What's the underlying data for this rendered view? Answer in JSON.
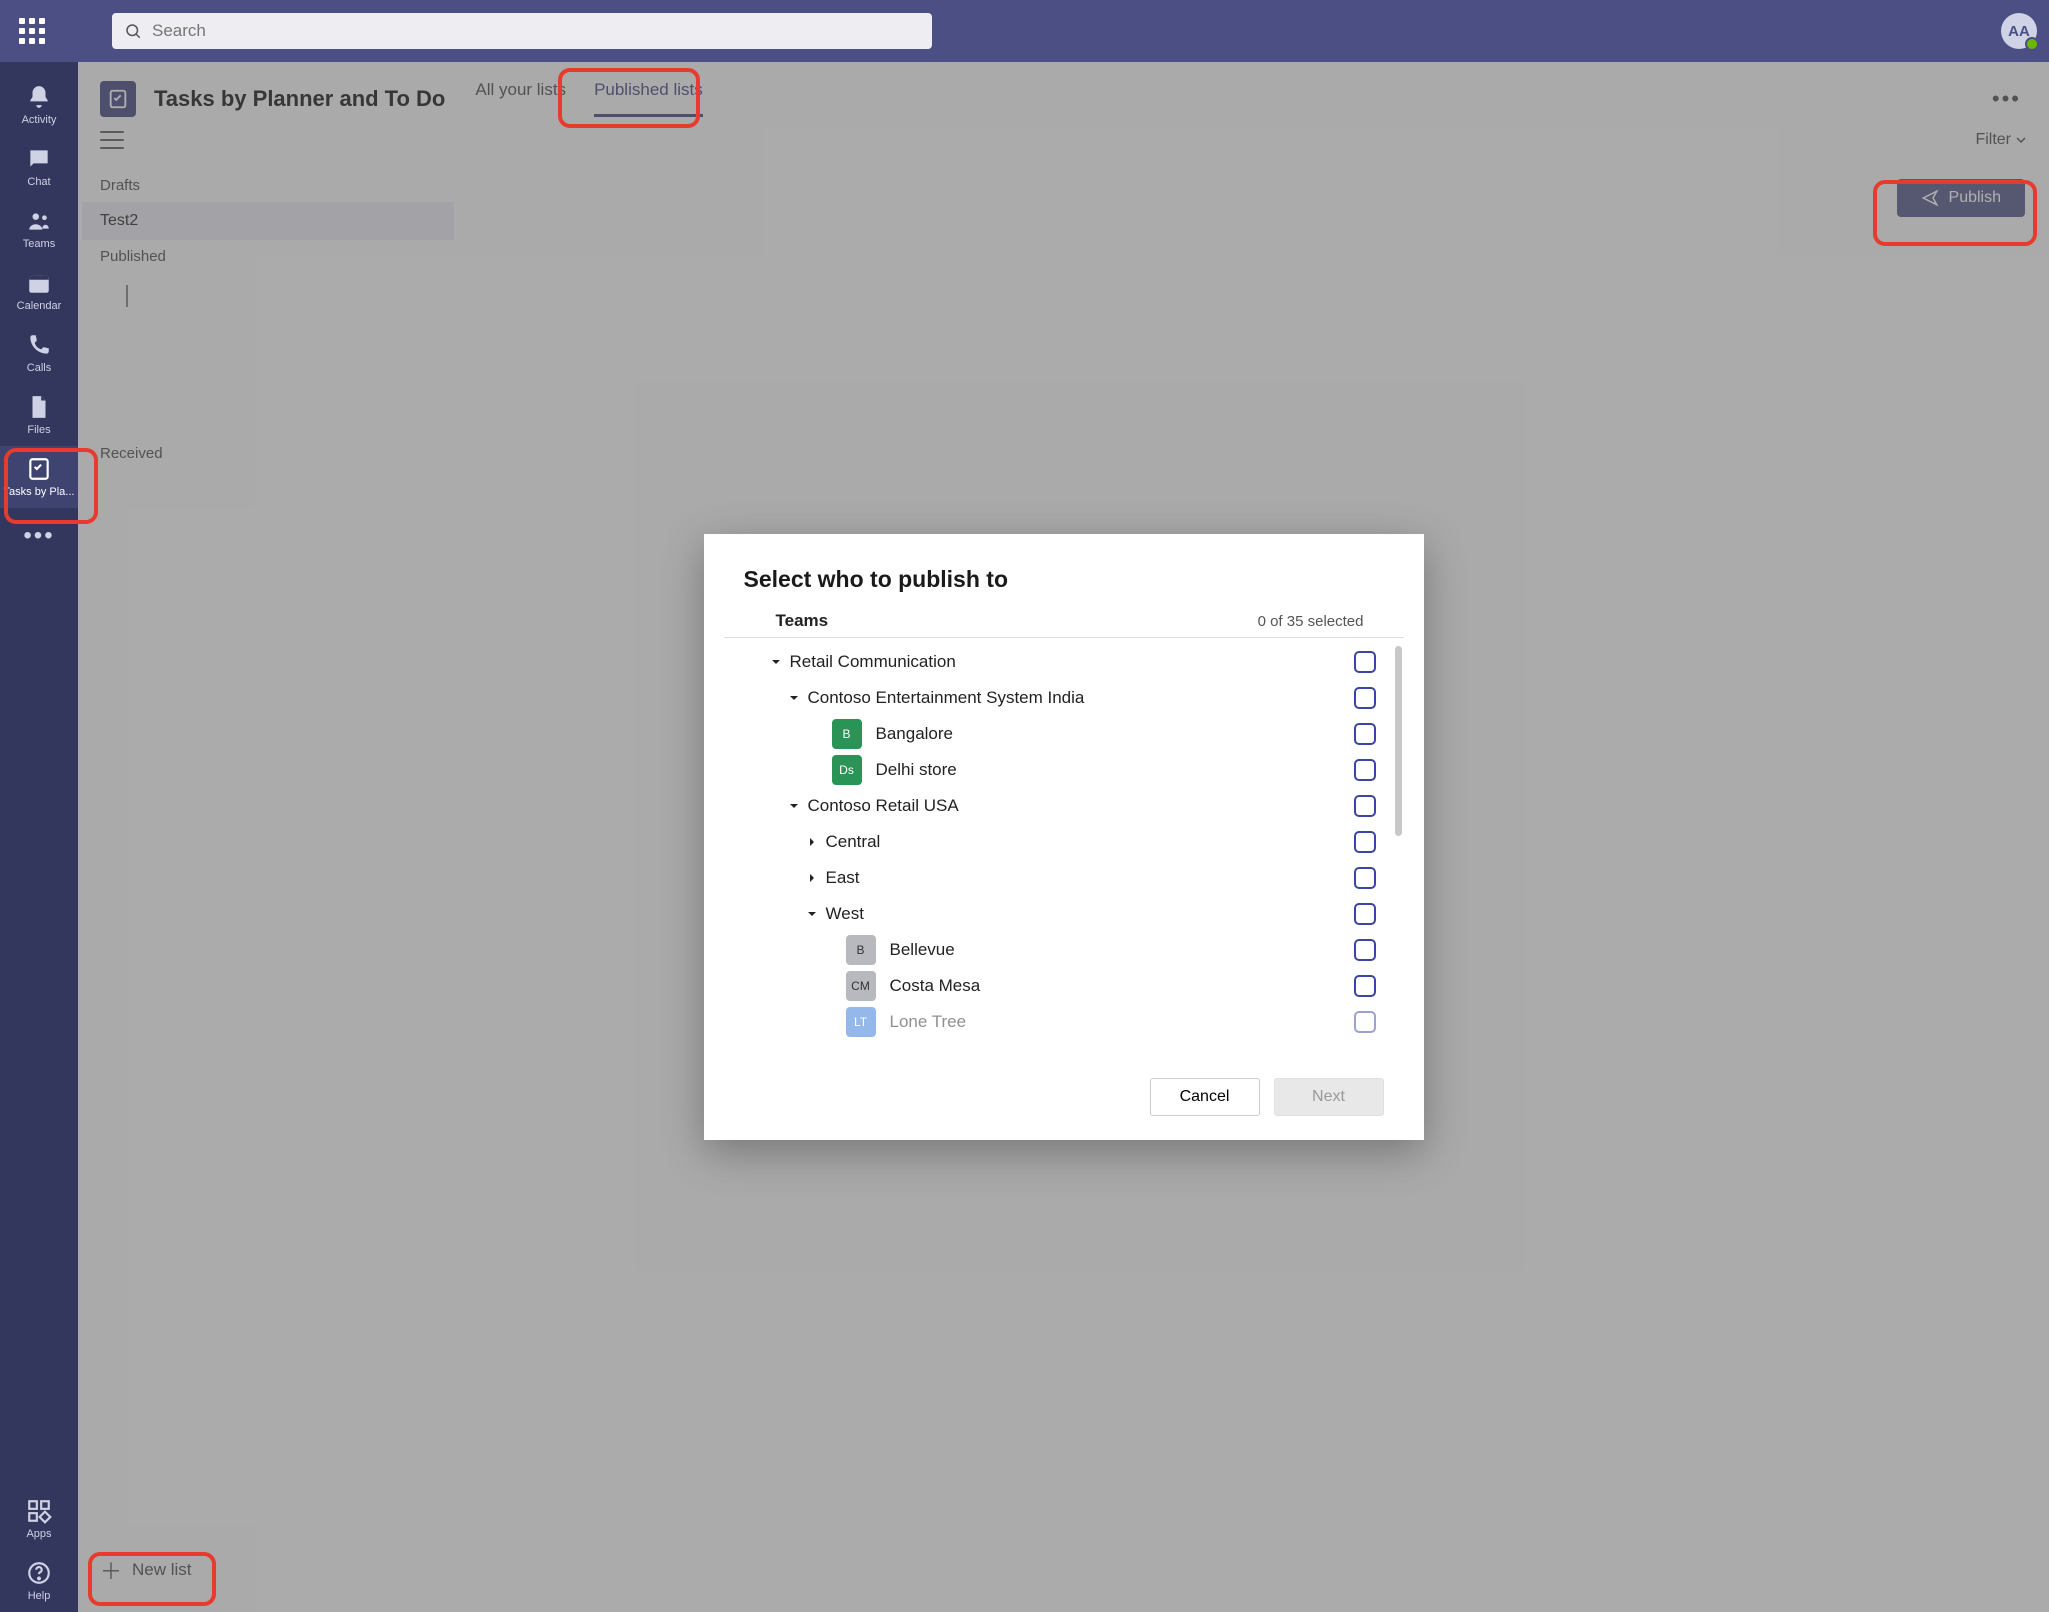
{
  "topbar": {
    "search_placeholder": "Search",
    "avatar_initials": "AA"
  },
  "rail": {
    "items": [
      {
        "label": "Activity"
      },
      {
        "label": "Chat"
      },
      {
        "label": "Teams"
      },
      {
        "label": "Calendar"
      },
      {
        "label": "Calls"
      },
      {
        "label": "Files"
      },
      {
        "label": "Tasks by Pla..."
      }
    ],
    "apps_label": "Apps",
    "help_label": "Help"
  },
  "header": {
    "app_title": "Tasks by Planner and To Do",
    "tabs": [
      {
        "label": "All your lists"
      },
      {
        "label": "Published lists"
      }
    ]
  },
  "subheader": {
    "filter_label": "Filter"
  },
  "sidepanel": {
    "sections": [
      {
        "label": "Drafts",
        "items": [
          {
            "label": "Test2"
          }
        ]
      },
      {
        "label": "Published",
        "items": []
      },
      {
        "label": "Received",
        "items": []
      }
    ],
    "new_list_label": "New list"
  },
  "canvas": {
    "publish_label": "Publish"
  },
  "dialog": {
    "title": "Select who to publish to",
    "teams_label": "Teams",
    "selected_count": "0 of 35 selected",
    "cancel_label": "Cancel",
    "next_label": "Next",
    "tree": {
      "root": "Retail Communication",
      "node_a": "Contoso Entertainment System India",
      "leaf_a1": "Bangalore",
      "leaf_a2": "Delhi store",
      "node_b": "Contoso Retail USA",
      "node_b1": "Central",
      "node_b2": "East",
      "node_b3": "West",
      "leaf_b3a": "Bellevue",
      "leaf_b3b": "Costa Mesa",
      "leaf_b3c": "Lone Tree",
      "badge_a1": "B",
      "badge_a2": "Ds",
      "badge_b3a": "B",
      "badge_b3b": "CM",
      "badge_b3c": "LT"
    }
  }
}
